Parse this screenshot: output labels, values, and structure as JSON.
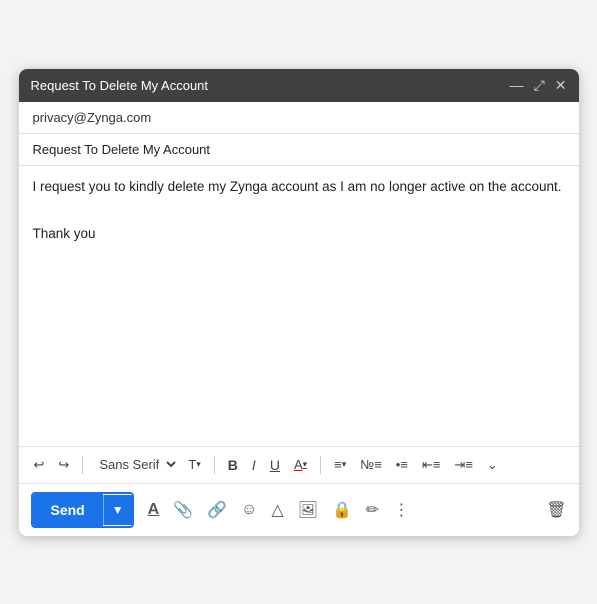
{
  "window": {
    "title": "Request To Delete My Account",
    "controls": {
      "minimize": "—",
      "expand": "⤢",
      "close": "✕"
    }
  },
  "fields": {
    "to": "privacy@Zynga.com",
    "subject": "Request To Delete My Account",
    "body_lines": [
      "I request you to kindly delete my Zynga account as I am no longer active on the account.",
      "",
      "Thank you"
    ]
  },
  "toolbar": {
    "undo": "↩",
    "redo": "↪",
    "font_family": "Sans Serif",
    "font_size_icon": "T↕",
    "bold": "B",
    "italic": "I",
    "underline": "U",
    "text_color": "A",
    "align": "≡",
    "numbered_list": "1≡",
    "bullet_list": "•≡",
    "indent_decrease": "⇤≡",
    "indent_increase": "⇥≡",
    "more": "⌄"
  },
  "bottom_bar": {
    "send_label": "Send",
    "send_dropdown_icon": "▾",
    "format_icon": "A",
    "attach_icon": "📎",
    "link_icon": "🔗",
    "emoji_icon": "☺",
    "drive_icon": "△",
    "photo_icon": "🖼",
    "lock_icon": "🔒",
    "pen_icon": "✏",
    "more_icon": "⋮",
    "delete_icon": "🗑"
  }
}
